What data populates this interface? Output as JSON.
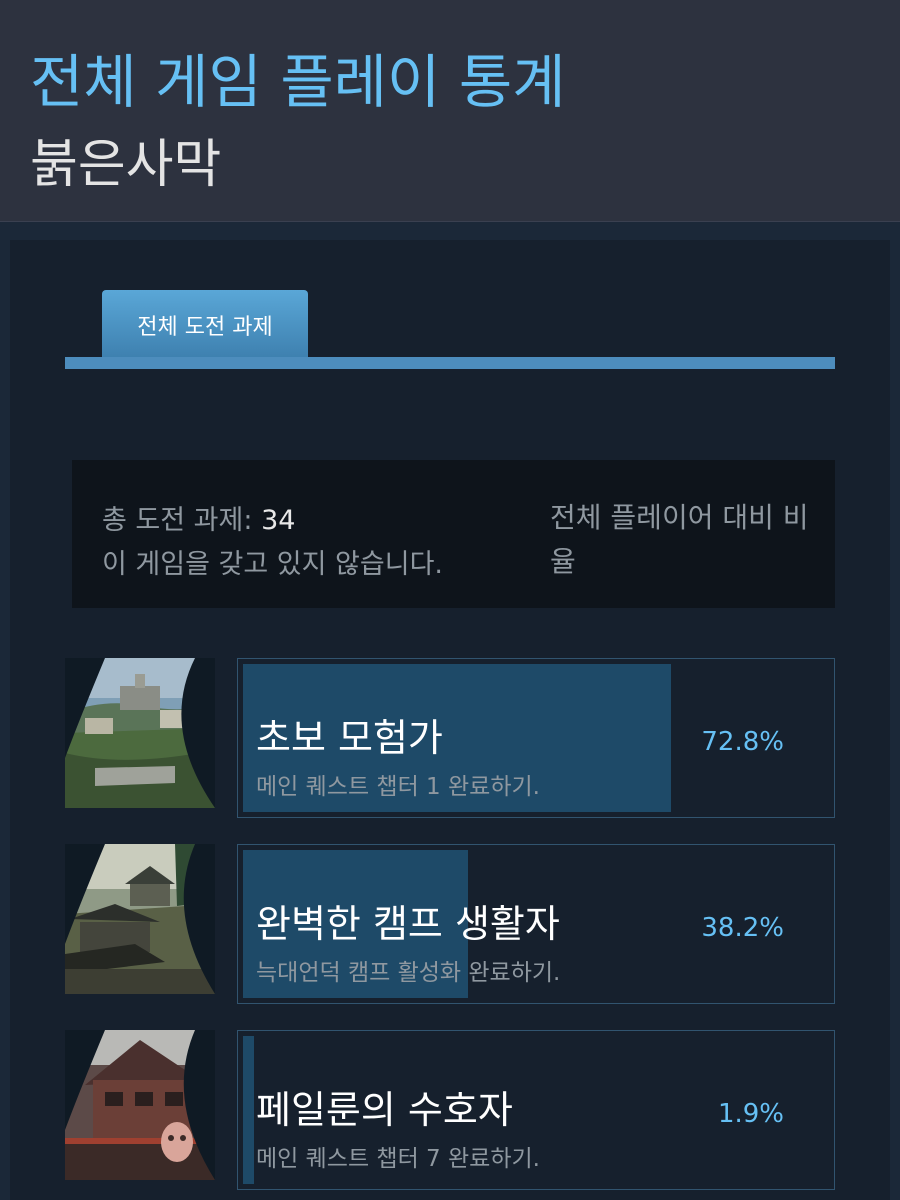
{
  "header": {
    "title": "전체 게임 플레이 통계",
    "game": "붉은사막"
  },
  "tabs": [
    {
      "label": "전체 도전 과제",
      "active": true
    }
  ],
  "summary": {
    "total_label": "총 도전 과제:",
    "total_value": "34",
    "ownership": "이 게임을 갖고 있지 않습니다.",
    "compare_label": "전체 플레이어 대비 비율"
  },
  "achievements": [
    {
      "name": "초보 모험가",
      "description": "메인 퀘스트 챕터 1 완료하기.",
      "percent_text": "72.8%",
      "percent": 72.8,
      "icon": "castle-landscape-icon"
    },
    {
      "name": "완벽한 캠프 생활자",
      "description": "늑대언덕 캠프 활성화 완료하기.",
      "percent_text": "38.2%",
      "percent": 38.2,
      "icon": "camp-village-icon"
    },
    {
      "name": "페일룬의 수호자",
      "description": "메인 퀘스트 챕터 7 완료하기.",
      "percent_text": "1.9%",
      "percent": 1.9,
      "icon": "fortress-mask-icon"
    }
  ],
  "colors": {
    "accent": "#66c0f4",
    "bar_fill": "#1e4a68",
    "header_bg": "#2d323f",
    "page_bg": "#16202d"
  }
}
